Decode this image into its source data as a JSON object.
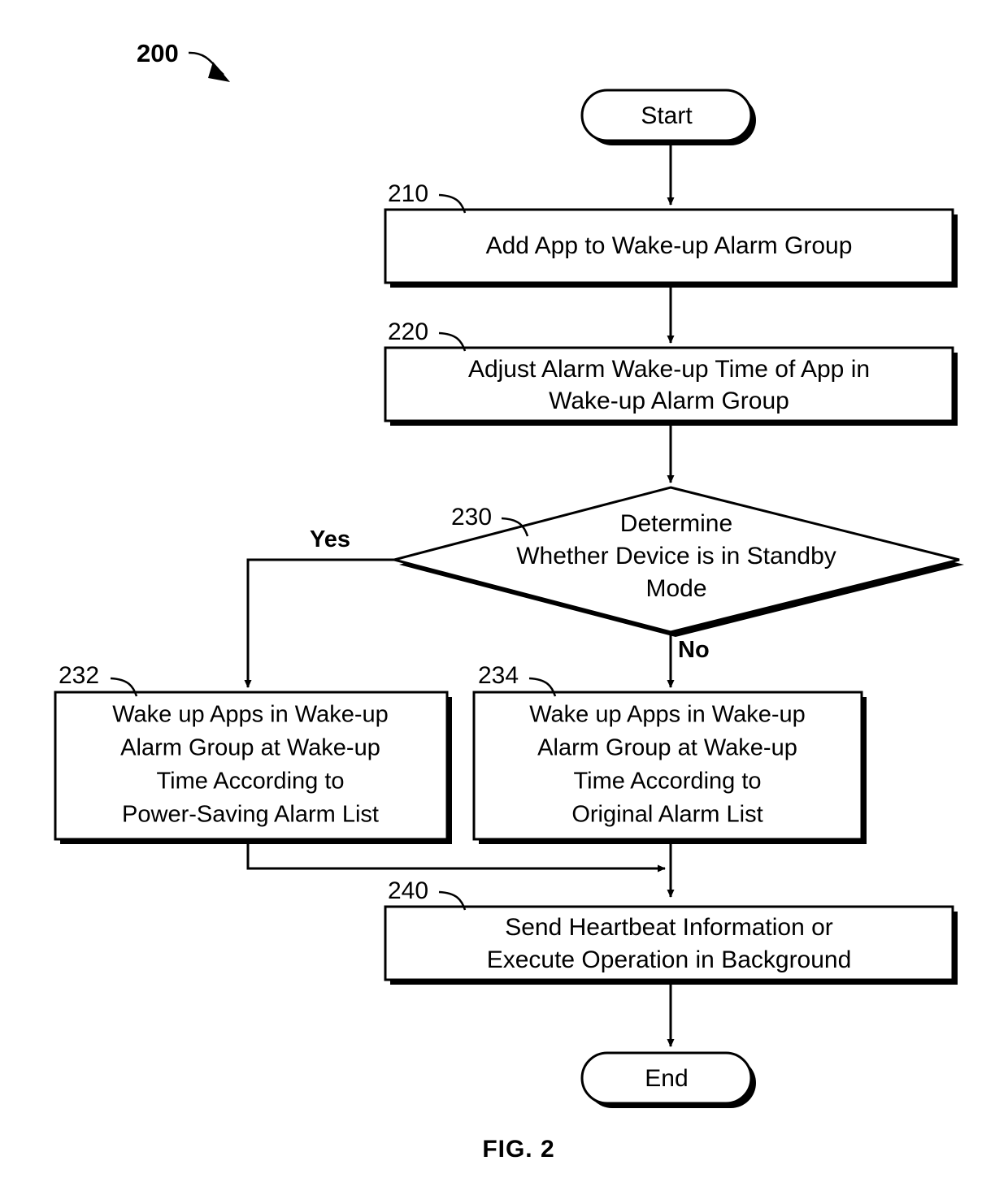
{
  "figure": {
    "number_label": "200",
    "caption": "FIG. 2"
  },
  "nodes": {
    "start": {
      "label": "Start",
      "shape": "stadium"
    },
    "step_210": {
      "ref": "210",
      "lines": [
        "Add App to Wake-up Alarm Group"
      ]
    },
    "step_220": {
      "ref": "220",
      "lines": [
        "Adjust Alarm Wake-up Time of App in",
        "Wake-up Alarm Group"
      ]
    },
    "decision_230": {
      "ref": "230",
      "lines": [
        "Determine",
        "Whether Device is in Standby",
        "Mode"
      ]
    },
    "step_232": {
      "ref": "232",
      "lines": [
        "Wake up Apps in Wake-up",
        "Alarm Group at Wake-up",
        "Time According to",
        "Power-Saving Alarm List"
      ]
    },
    "step_234": {
      "ref": "234",
      "lines": [
        "Wake up Apps in Wake-up",
        "Alarm Group at Wake-up",
        "Time According to",
        "Original Alarm List"
      ]
    },
    "step_240": {
      "ref": "240",
      "lines": [
        "Send Heartbeat Information or",
        "Execute Operation in Background"
      ]
    },
    "end": {
      "label": "End",
      "shape": "stadium"
    }
  },
  "branches": {
    "yes": "Yes",
    "no": "No"
  },
  "colors": {
    "stroke": "#000000",
    "fill": "#ffffff",
    "background": "#ffffff"
  }
}
